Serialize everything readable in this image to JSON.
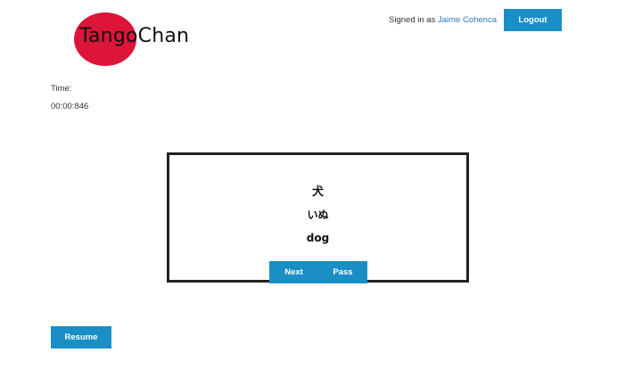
{
  "brand": {
    "name": "TangoChan",
    "accent": "#dc1539",
    "button_color": "#1a8fc6"
  },
  "header": {
    "signed_in_prefix": "Signed in as",
    "username": "Jaime Cohenca",
    "logout_label": "Logout"
  },
  "timer": {
    "label": "Time:",
    "value": "00:00:846"
  },
  "card": {
    "kanji": "犬",
    "kana": "いぬ",
    "meaning": "dog"
  },
  "controls": {
    "next_label": "Next",
    "pass_label": "Pass",
    "resume_label": "Resume"
  }
}
